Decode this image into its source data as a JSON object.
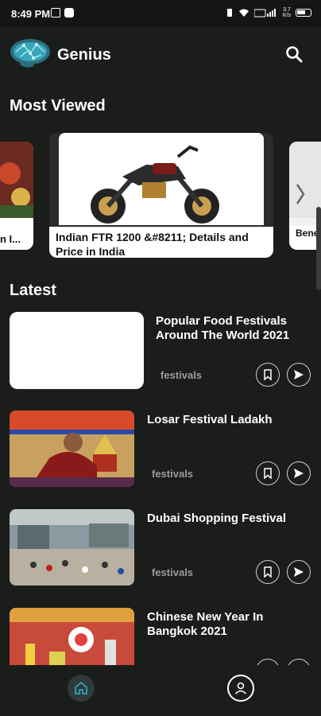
{
  "status_bar": {
    "time": "8:49 PM",
    "net_speed_top": "3.7",
    "net_speed_bottom": "K/s"
  },
  "header": {
    "title": "Genius"
  },
  "sections": {
    "most_viewed": "Most Viewed",
    "latest": "Latest"
  },
  "most_viewed": {
    "left_partial": "n I...",
    "main_title": "Indian FTR 1200 &#8211; Details and Price in India",
    "right_partial": "Bene"
  },
  "latest": [
    {
      "title": "Popular Food Festivals Around The World 2021",
      "tag": "festivals"
    },
    {
      "title": "Losar Festival Ladakh",
      "tag": "festivals"
    },
    {
      "title": "Dubai Shopping Festival",
      "tag": "festivals"
    },
    {
      "title": "Chinese New Year In Bangkok 2021",
      "tag": ""
    }
  ],
  "colors": {
    "accent": "#2aa8b8",
    "background": "#1b1d1b",
    "tag_text": "#9a9c9a"
  },
  "icons": {
    "search": "search-icon",
    "bookmark": "bookmark-icon",
    "share": "send-icon",
    "home": "home-icon",
    "profile": "profile-icon"
  }
}
